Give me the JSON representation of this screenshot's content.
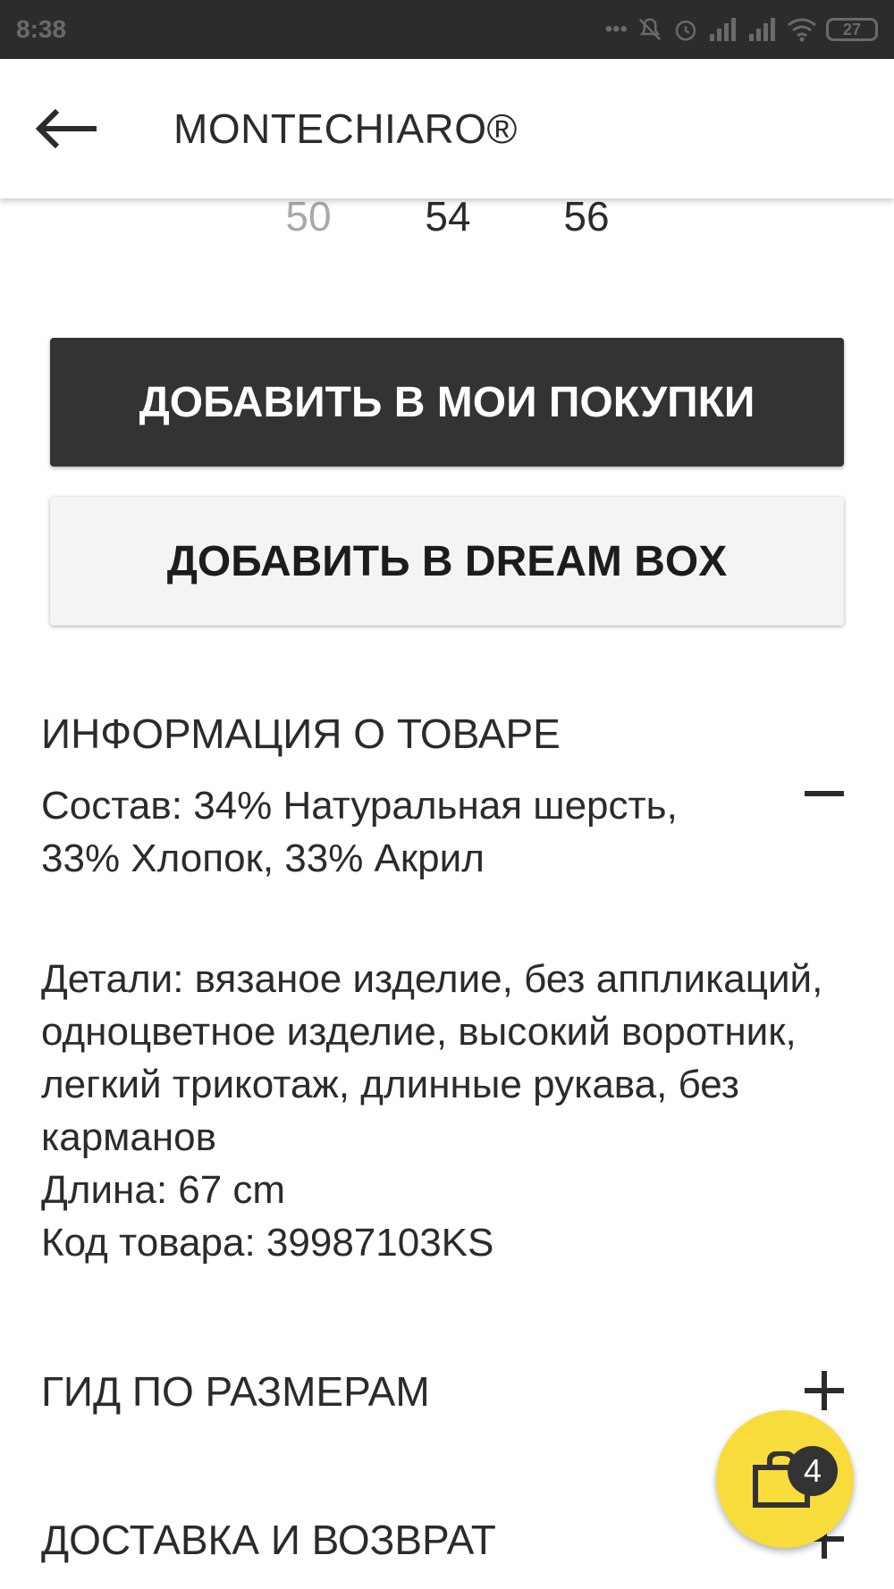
{
  "status_bar": {
    "time": "8:38",
    "dots": "•••",
    "battery": "27",
    "icons": [
      "mute-icon",
      "alarm-icon",
      "signal-icon",
      "signal-icon",
      "wifi-icon",
      "battery-icon"
    ]
  },
  "app_bar": {
    "title": "MONTECHIARO®",
    "back_icon": "arrow-left-icon"
  },
  "sizes": [
    {
      "label": "50",
      "available": false
    },
    {
      "label": "54",
      "available": true
    },
    {
      "label": "56",
      "available": true
    }
  ],
  "actions": {
    "add_to_cart": "ДОБАВИТЬ В МОИ ПОКУПКИ",
    "add_to_dreambox": "ДОБАВИТЬ В DREAM BOX"
  },
  "product_info": {
    "title": "ИНФОРМАЦИЯ О ТОВАРЕ",
    "composition": "Состав: 34% Натуральная шерсть, 33% Хлопок, 33% Акрил",
    "details": "Детали: вязаное изделие, без аппликаций, одноцветное изделие, высокий воротник, легкий трикотаж, длинные рукава, без карманов",
    "length": "Длина: 67 cm",
    "code": "Код товара: 39987103KS",
    "expanded": true
  },
  "size_guide": {
    "title": "ГИД ПО РАЗМЕРАМ"
  },
  "delivery": {
    "title": "ДОСТАВКА И ВОЗВРАТ"
  },
  "cart_fab": {
    "count": "4",
    "icon": "shopping-bag-icon",
    "color": "#f7dc3c"
  }
}
